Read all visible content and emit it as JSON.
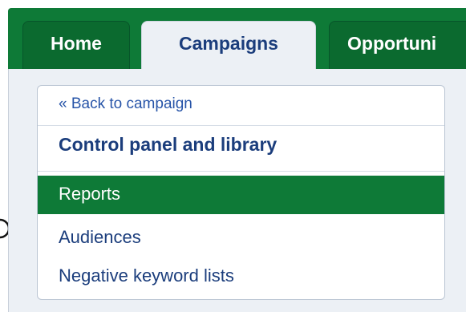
{
  "tabs": [
    {
      "label": "Home",
      "active": false
    },
    {
      "label": "Campaigns",
      "active": true
    },
    {
      "label": "Opportuni",
      "active": false
    }
  ],
  "panel": {
    "back_link": "« Back to campaign",
    "heading": "Control panel and library",
    "items": [
      {
        "label": "Reports",
        "active": true
      },
      {
        "label": "Audiences",
        "active": false
      },
      {
        "label": "Negative keyword lists",
        "active": false
      }
    ]
  },
  "colors": {
    "brand_green": "#0e7a37",
    "link_blue": "#2754a8",
    "heading_navy": "#1b3d7c",
    "content_bg": "#ecf0f5"
  }
}
